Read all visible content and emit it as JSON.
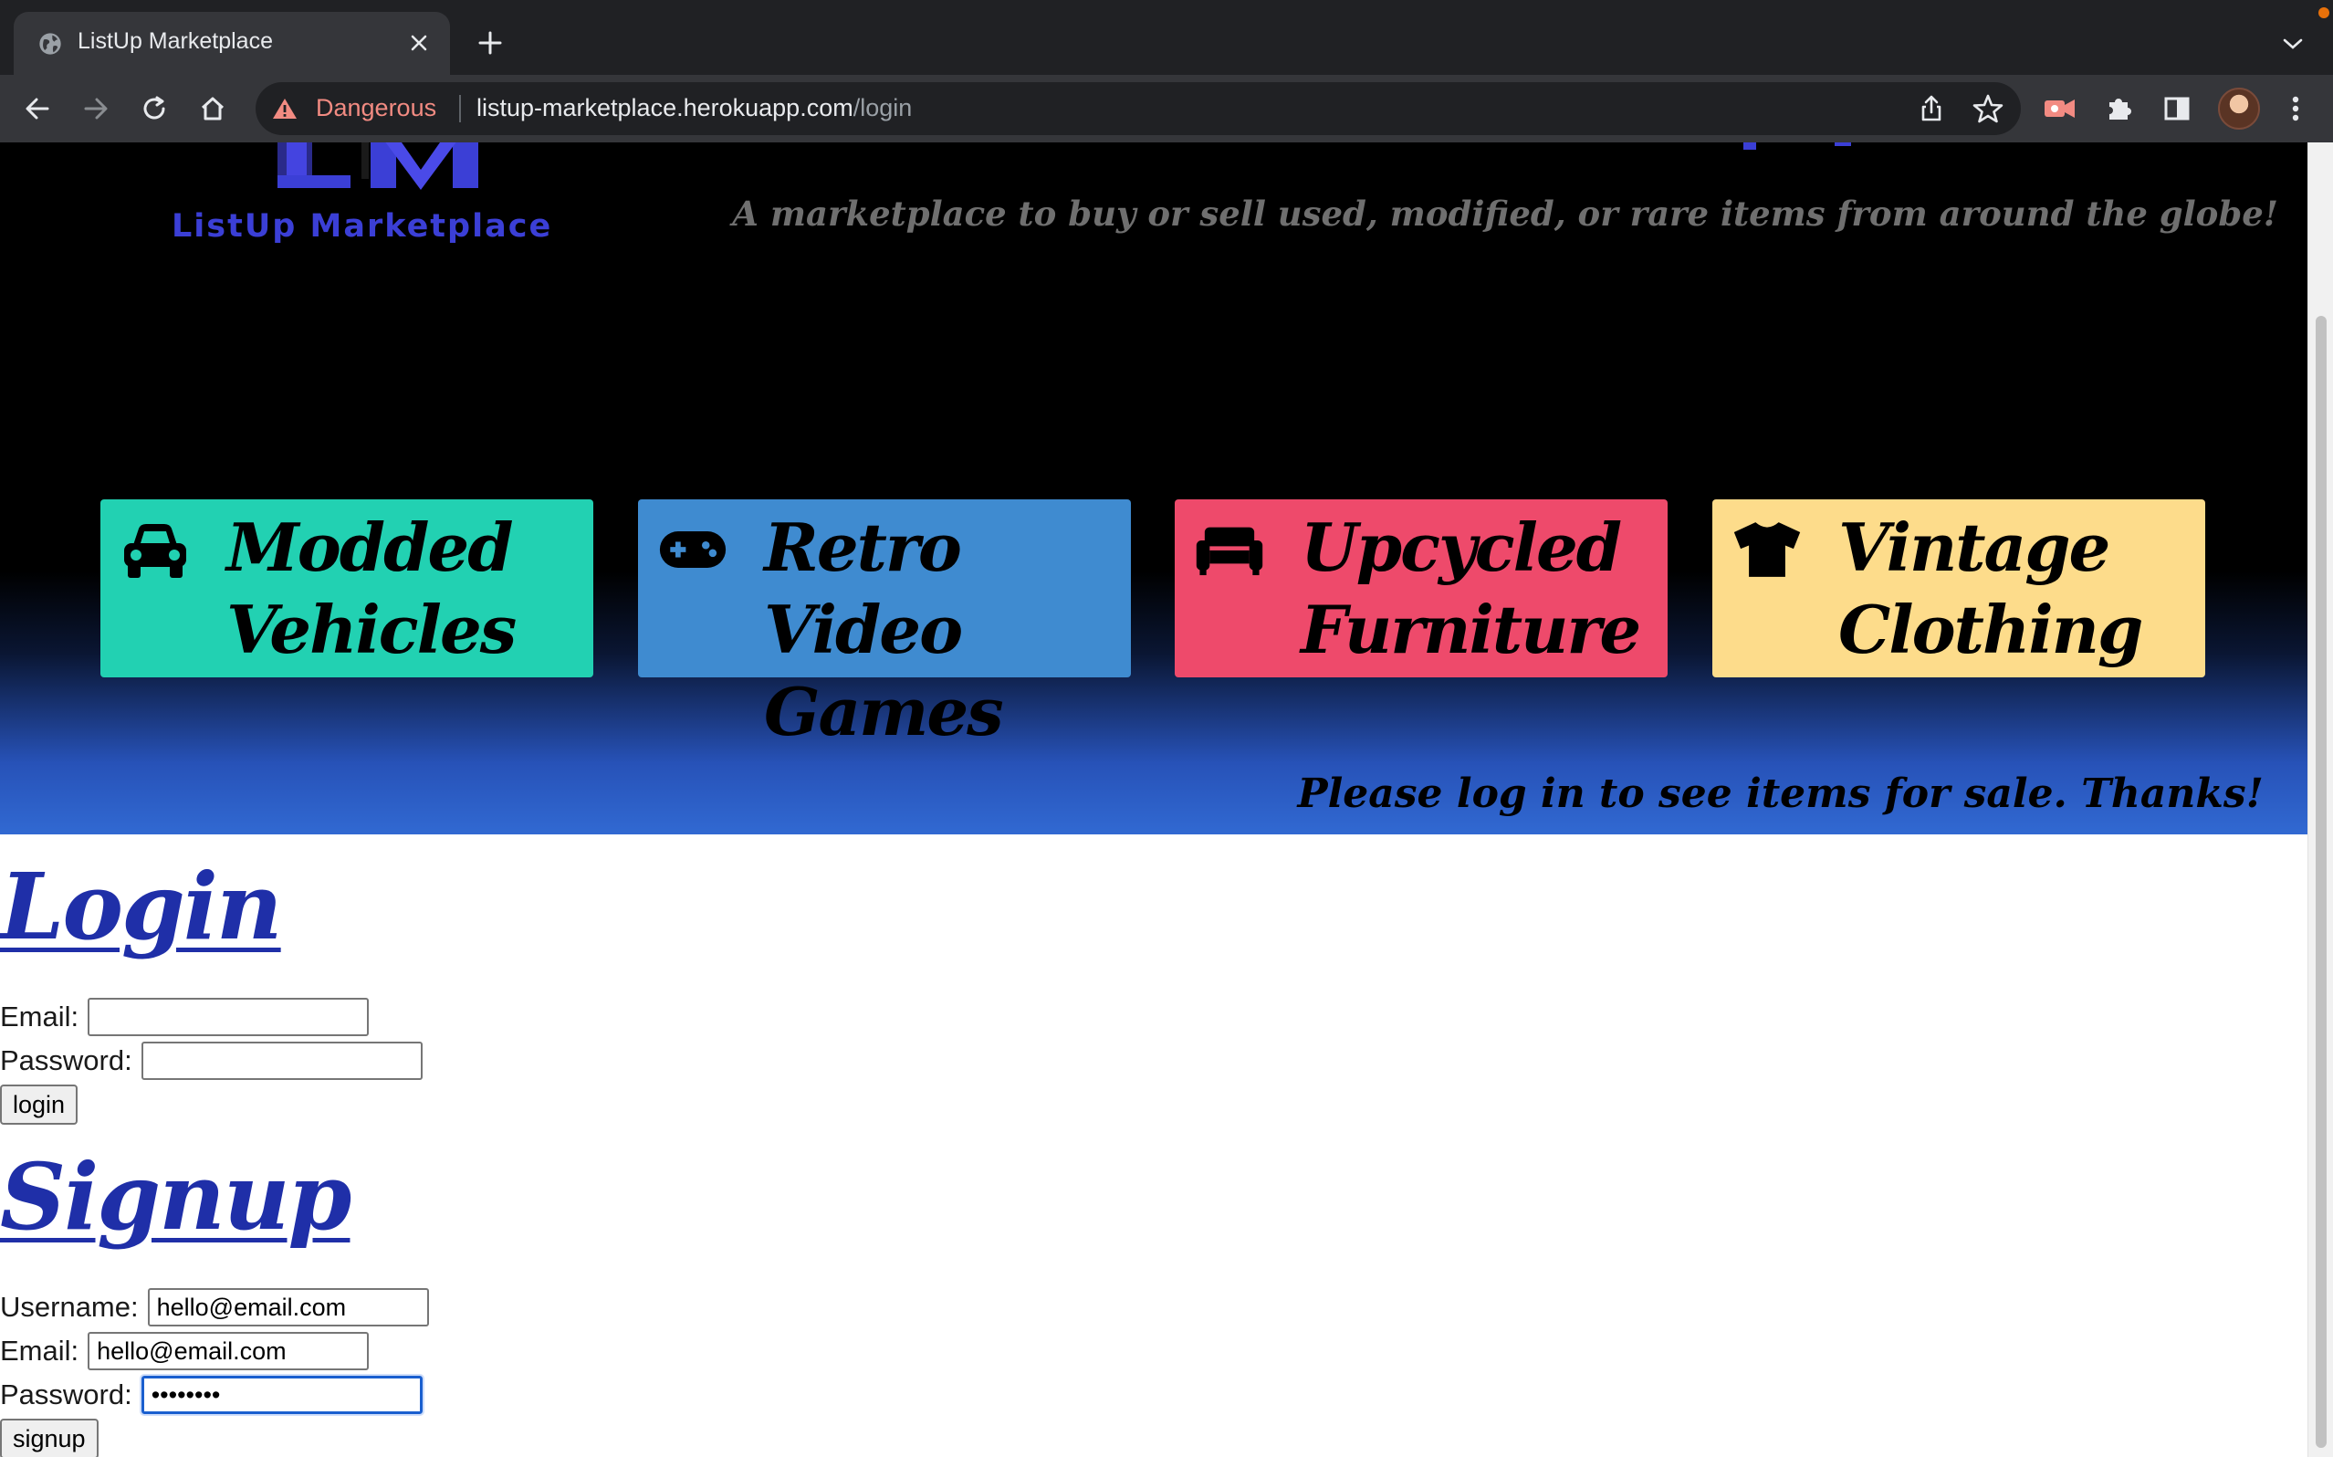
{
  "browser": {
    "tab_title": "ListUp Marketplace",
    "security_label": "Dangerous",
    "url_host": "listup-marketplace.herokuapp.com",
    "url_path": "/login",
    "icons": {
      "tab": "globe-icon",
      "close": "close-icon",
      "new_tab": "plus-icon",
      "back": "back-arrow-icon",
      "forward": "forward-arrow-icon",
      "reload": "reload-icon",
      "home": "home-icon",
      "warning": "warning-triangle-icon",
      "share": "share-icon",
      "bookmark": "star-icon",
      "extension_record": "record-extension-icon",
      "extensions": "puzzle-icon",
      "side_panel": "side-panel-icon",
      "menu": "kebab-menu-icon"
    }
  },
  "hero": {
    "logo_text": "ListUp Marketplace",
    "tagline": "A marketplace to buy or sell used, modified, or rare items from around the globe!",
    "notice": "Please log in to see items for sale. Thanks!",
    "categories": [
      {
        "label": "Modded Vehicles",
        "icon": "car-icon",
        "color": "#22d1b2"
      },
      {
        "label": "Retro Video Games",
        "icon": "gamepad-icon",
        "color": "#3f8bd0"
      },
      {
        "label": "Upcycled Furniture",
        "icon": "couch-icon",
        "color": "#ee4a6b"
      },
      {
        "label": "Vintage Clothing",
        "icon": "tshirt-icon",
        "color": "#fddc8b"
      }
    ]
  },
  "login": {
    "title": "Login",
    "email_label": "Email:",
    "email_value": "",
    "password_label": "Password:",
    "password_value": "",
    "button": "login"
  },
  "signup": {
    "title": "Signup",
    "username_label": "Username:",
    "username_value": "hello@email.com",
    "email_label": "Email:",
    "email_value": "hello@email.com",
    "password_label": "Password:",
    "password_value": "••••••••",
    "button": "signup"
  },
  "colors": {
    "heading": "#1f2fa8",
    "chrome_dark": "#202124",
    "chrome_mid": "#35363a",
    "danger": "#f28b82"
  }
}
